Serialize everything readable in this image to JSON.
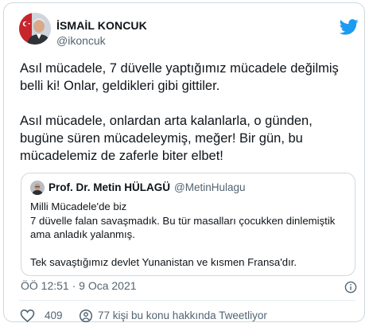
{
  "author": {
    "name": "İSMAİL KONCUK",
    "handle": "@ikoncuk"
  },
  "tweet": {
    "text": "Asıl mücadele, 7 düvelle yaptığımız mücadele değilmiş belli ki! Onlar, geldikleri gibi gittiler.\n\nAsıl mücadele, onlardan arta kalanlarla, o günden, bugüne süren mücadeleymiş, meğer! Bir gün, bu mücadelemiz de zaferle biter elbet!"
  },
  "quote": {
    "name": "Prof. Dr. Metin HÜLAGÜ",
    "handle": "@MetinHulagu",
    "text": "Milli Mücadele'de biz\n7 düvelle falan savaşmadık. Bu tür masalları çocukken dinlemiştik ama anladık yalanmış.\n\nTek savaştığımız devlet Yunanistan ve kısmen Fransa'dır."
  },
  "meta": {
    "timestamp": "ÖÖ 12:51 · 9 Oca 2021"
  },
  "actions": {
    "like_count": "409",
    "reply_text": "77 kişi bu konu hakkında Tweetliyor"
  },
  "colors": {
    "twitter_blue": "#1d9bf0",
    "muted_text": "#536471",
    "border": "#cfd9de"
  }
}
